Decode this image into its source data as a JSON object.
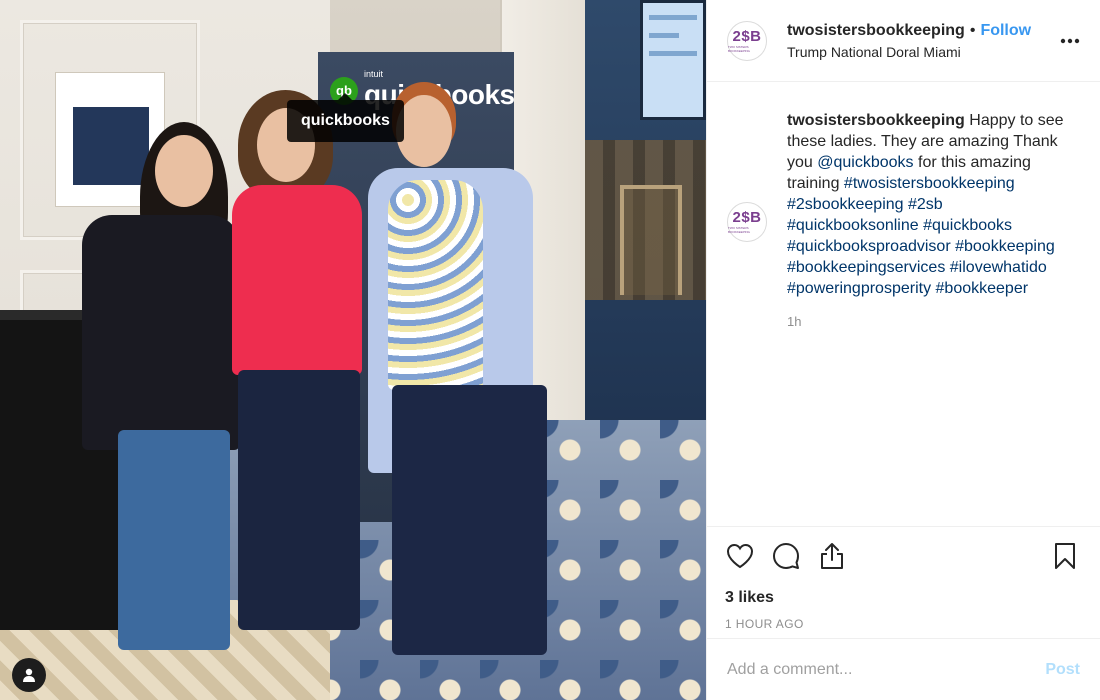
{
  "photo": {
    "tag_label": "quickbooks",
    "sign_brand_small": "intuit",
    "sign_brand": "quickbooks",
    "tagged_user_icon": "user-silhouette-icon"
  },
  "header": {
    "avatar_mark": "2$B",
    "avatar_sub": "TWO SISTERS BOOKKEEPING",
    "username": "twosistersbookkeeping",
    "separator": "•",
    "follow_label": "Follow",
    "location": "Trump National Doral Miami",
    "more_icon": "more-horizontal-icon"
  },
  "caption": {
    "username": "twosistersbookkeeping",
    "text_1": " Happy to see these ladies. They are amazing Thank you ",
    "mention": "@quickbooks",
    "text_2": " for this amazing training ",
    "hashtags": [
      "#twosistersbookkeeping",
      "#2sbookkeeping",
      "#2sb",
      "#quickbooksonline",
      "#quickbooks",
      "#quickbooksproadvisor",
      "#bookkeeping",
      "#bookkeepingservices",
      "#ilovewhatido",
      "#poweringprosperity",
      "#bookkeeper"
    ],
    "time": "1h"
  },
  "actions": {
    "like_icon": "heart-icon",
    "comment_icon": "comment-icon",
    "share_icon": "share-icon",
    "save_icon": "bookmark-icon",
    "likes_text": "3 likes",
    "time_ago": "1 HOUR AGO"
  },
  "comment": {
    "placeholder": "Add a comment...",
    "post_label": "Post",
    "post_color": "#b2dffc"
  },
  "colors": {
    "link": "#003569",
    "follow": "#3897f0",
    "muted": "#8e8e8e"
  }
}
